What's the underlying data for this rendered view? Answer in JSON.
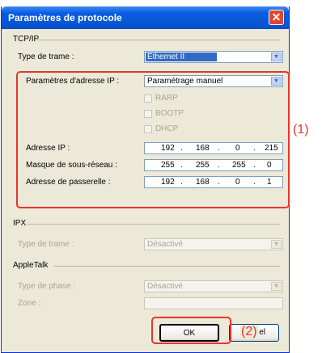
{
  "window": {
    "title": "Paramètres de protocole",
    "close_glyph": "✕"
  },
  "tcpip": {
    "group_label": "TCP/IP",
    "frame_type_label": "Type de trame :",
    "frame_type_value": "Ethernet II",
    "ip_settings_label": "Paramètres d'adresse IP :",
    "ip_settings_value": "Paramétrage manuel",
    "rarp_label": "RARP",
    "bootp_label": "BOOTP",
    "dhcp_label": "DHCP",
    "ip_address_label": "Adresse IP :",
    "ip_address": [
      "192",
      "168",
      "0",
      "215"
    ],
    "subnet_label": "Masque de sous-réseau :",
    "subnet": [
      "255",
      "255",
      "255",
      "0"
    ],
    "gateway_label": "Adresse de passerelle :",
    "gateway": [
      "192",
      "168",
      "0",
      "1"
    ],
    "dot": "."
  },
  "ipx": {
    "group_label": "IPX",
    "frame_type_label": "Type de trame :",
    "frame_type_value": "Désactivé"
  },
  "appletalk": {
    "group_label": "AppleTalk",
    "phase_label": "Type de phase :",
    "phase_value": "Désactivé",
    "zone_label": "Zone :",
    "zone_value": ""
  },
  "buttons": {
    "ok_label": "OK",
    "cancel_label_partial": "el"
  },
  "callouts": {
    "one": "(1)",
    "two": "(2)"
  },
  "colors": {
    "annotation": "#e8352a",
    "title_bar": "#0a5be1"
  }
}
